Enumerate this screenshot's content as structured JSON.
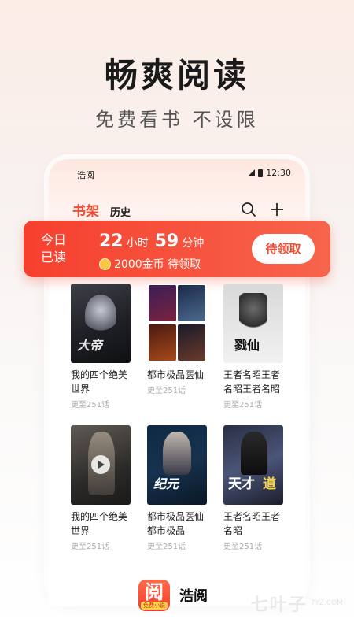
{
  "headline": "畅爽阅读",
  "subline": "免费看书 不设限",
  "status_bar": {
    "app_name": "浩阅",
    "time": "12:30"
  },
  "tabs": {
    "bookshelf": "书架",
    "history": "历史"
  },
  "banner": {
    "today_read": "今日已读",
    "hours": "22",
    "hours_unit": "小时",
    "minutes": "59",
    "minutes_unit": "分钟",
    "coins_text": "2000金币 待领取",
    "claim_button": "待领取"
  },
  "books": [
    {
      "title": "我的四个绝美世界",
      "update": "更至251话"
    },
    {
      "title": "都市极品医仙",
      "update": "更至251话"
    },
    {
      "title": "王者名昭王者名昭王者名昭",
      "update": "更至251话"
    },
    {
      "title": "我的四个绝美世界",
      "update": "更至251话"
    },
    {
      "title": "都市极品医仙都市极品",
      "update": "更至251话"
    },
    {
      "title": "王者名昭王者名昭",
      "update": "更至251话"
    }
  ],
  "footer": {
    "logo_char": "阅",
    "logo_tag": "免费小说",
    "brand": "浩阅"
  },
  "watermark": {
    "text": "七叶子",
    "sub": "7YZ.COM"
  },
  "colors": {
    "accent": "#f24b33",
    "banner": "#f6402e"
  }
}
